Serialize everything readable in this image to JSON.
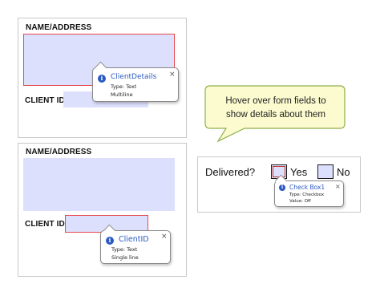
{
  "panel_top": {
    "name_label": "NAME/ADDRESS",
    "client_id_label": "CLIENT ID:",
    "tooltip": {
      "title": "ClientDetails",
      "line1": "Type: Text",
      "line2": "Multiline",
      "close": "×"
    }
  },
  "panel_bottom": {
    "name_label": "NAME/ADDRESS",
    "client_id_label": "CLIENT ID:",
    "tooltip": {
      "title": "ClientID",
      "line1": "Type: Text",
      "line2": "Single line",
      "close": "×"
    }
  },
  "callout": {
    "line1": "Hover over form fields to",
    "line2": "show details about them"
  },
  "checkbox_panel": {
    "question": "Delivered?",
    "yes_label": "Yes",
    "no_label": "No",
    "tooltip": {
      "title": "Check Box1",
      "line1": "Type: Checkbox",
      "line2": "Value: Off",
      "close": "×"
    }
  },
  "icons": {
    "info": "info-icon",
    "close": "close-icon"
  },
  "colors": {
    "field_fill": "#dde0fd",
    "active_border": "#e8484c",
    "tooltip_title": "#2b59c3",
    "callout_fill": "#fbfbcf",
    "callout_border": "#8fb04a"
  }
}
